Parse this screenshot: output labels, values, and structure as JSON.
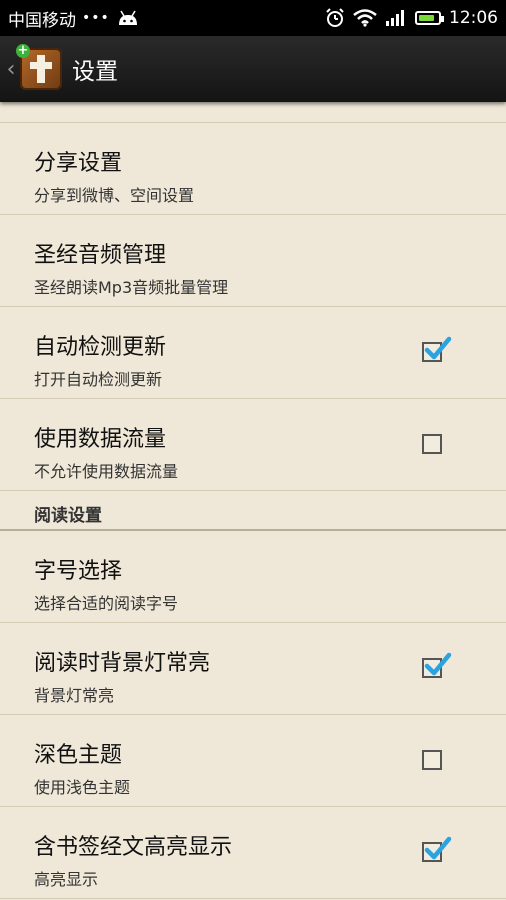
{
  "status_bar": {
    "carrier": "中国移动",
    "dots": "•••",
    "time": "12:06"
  },
  "action_bar": {
    "title": "设置"
  },
  "settings": {
    "items": [
      {
        "title": "分享设置",
        "subtitle": "分享到微博、空间设置",
        "checkbox": null
      },
      {
        "title": "圣经音频管理",
        "subtitle": "圣经朗读Mp3音频批量管理",
        "checkbox": null
      },
      {
        "title": "自动检测更新",
        "subtitle": "打开自动检测更新",
        "checkbox": true
      },
      {
        "title": "使用数据流量",
        "subtitle": "不允许使用数据流量",
        "checkbox": false
      }
    ],
    "reading_section": {
      "header": "阅读设置",
      "items": [
        {
          "title": "字号选择",
          "subtitle": "选择合适的阅读字号",
          "checkbox": null
        },
        {
          "title": "阅读时背景灯常亮",
          "subtitle": "背景灯常亮",
          "checkbox": true
        },
        {
          "title": "深色主题",
          "subtitle": "使用浅色主题",
          "checkbox": false
        },
        {
          "title": "含书签经文高亮显示",
          "subtitle": "高亮显示",
          "checkbox": true
        }
      ]
    }
  },
  "icons": [
    "android-icon",
    "alarm-icon",
    "wifi-icon",
    "signal-icon",
    "battery-icon",
    "back-chevron-icon",
    "bible-app-icon",
    "checkbox-icon",
    "checkmark-icon"
  ],
  "colors": {
    "check": "#2aa3e0",
    "battery": "#7cd93a"
  }
}
